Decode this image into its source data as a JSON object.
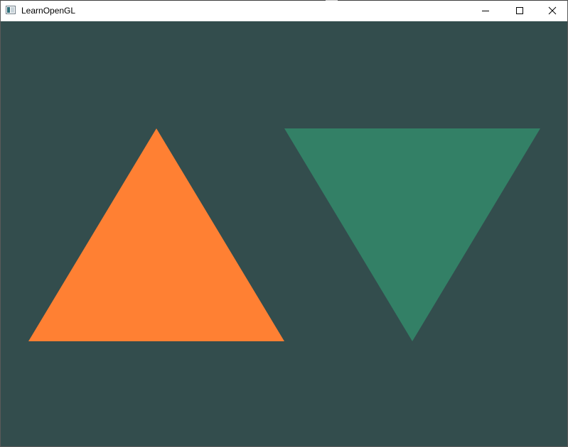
{
  "window": {
    "title": "LearnOpenGL",
    "controls": {
      "minimize_icon": "minimize-icon",
      "maximize_icon": "maximize-icon",
      "close_icon": "close-icon"
    }
  },
  "scene": {
    "clear_color": "#334d4d",
    "shapes": [
      {
        "name": "orange-triangle",
        "color": "#ff8033",
        "orientation": "pointing-up"
      },
      {
        "name": "green-triangle",
        "color": "#338066",
        "orientation": "pointing-down"
      }
    ]
  }
}
